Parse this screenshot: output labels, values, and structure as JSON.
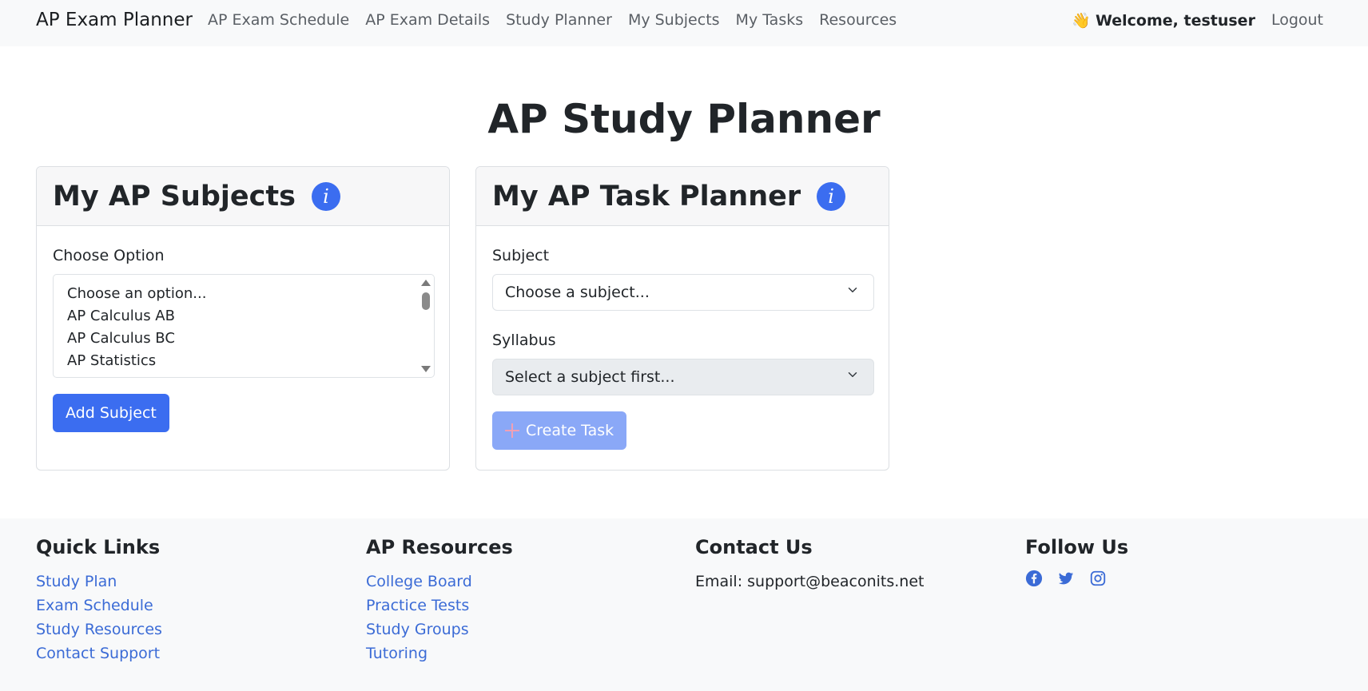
{
  "navbar": {
    "brand": "AP Exam Planner",
    "links": [
      "AP Exam Schedule",
      "AP Exam Details",
      "Study Planner",
      "My Subjects",
      "My Tasks",
      "Resources"
    ],
    "welcome_icon": "👋",
    "welcome": "Welcome, testuser",
    "logout": "Logout"
  },
  "page": {
    "title": "AP Study Planner"
  },
  "subjects_card": {
    "title": "My AP Subjects",
    "info_glyph": "i",
    "choose_label": "Choose Option",
    "options": [
      "Choose an option...",
      "AP Calculus AB",
      "AP Calculus BC",
      "AP Statistics"
    ],
    "add_button": "Add Subject"
  },
  "tasks_card": {
    "title": "My AP Task Planner",
    "info_glyph": "i",
    "subject_label": "Subject",
    "subject_value": "Choose a subject...",
    "syllabus_label": "Syllabus",
    "syllabus_value": "Select a subject first...",
    "create_button": "Create Task"
  },
  "footer": {
    "quick_links": {
      "heading": "Quick Links",
      "items": [
        "Study Plan",
        "Exam Schedule",
        "Study Resources",
        "Contact Support"
      ]
    },
    "ap_resources": {
      "heading": "AP Resources",
      "items": [
        "College Board",
        "Practice Tests",
        "Study Groups",
        "Tutoring"
      ]
    },
    "contact": {
      "heading": "Contact Us",
      "email": "Email: support@beaconits.net"
    },
    "follow": {
      "heading": "Follow Us",
      "icons": [
        "facebook-icon",
        "twitter-icon",
        "instagram-icon"
      ]
    }
  },
  "colors": {
    "primary": "#3b6df0",
    "link": "#3b6bd6",
    "navbar_bg": "#f8f9fa",
    "disabled_button": "#8aa8f7"
  }
}
